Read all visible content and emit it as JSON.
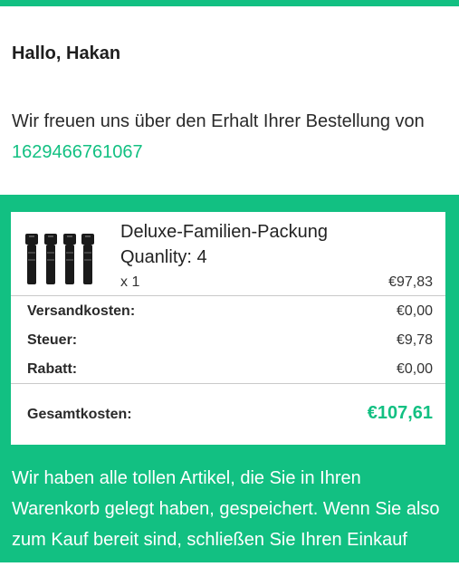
{
  "header": {
    "accent_color": "#12c082"
  },
  "greeting": "Hallo, Hakan",
  "intro": {
    "text": "Wir freuen uns über den Erhalt Ihrer Bestellung von",
    "order_number": "1629466761067"
  },
  "product": {
    "image_icon": "flashlight-pack-icon",
    "name": "Deluxe-Familien-Packung",
    "quantity_label": "Quanlity: 4",
    "multiplier": "x 1",
    "price": "€97,83"
  },
  "summary": {
    "shipping_label": "Versandkosten:",
    "shipping_value": "€0,00",
    "tax_label": "Steuer:",
    "tax_value": "€9,78",
    "discount_label": "Rabatt:",
    "discount_value": "€0,00",
    "total_label": "Gesamtkosten:",
    "total_value": "€107,61"
  },
  "footer": {
    "text": "Wir haben alle tollen Artikel, die Sie in Ihren Warenkorb gelegt haben, gespeichert. Wenn Sie also zum Kauf bereit sind, schließen Sie Ihren Einkauf einfach ab."
  }
}
